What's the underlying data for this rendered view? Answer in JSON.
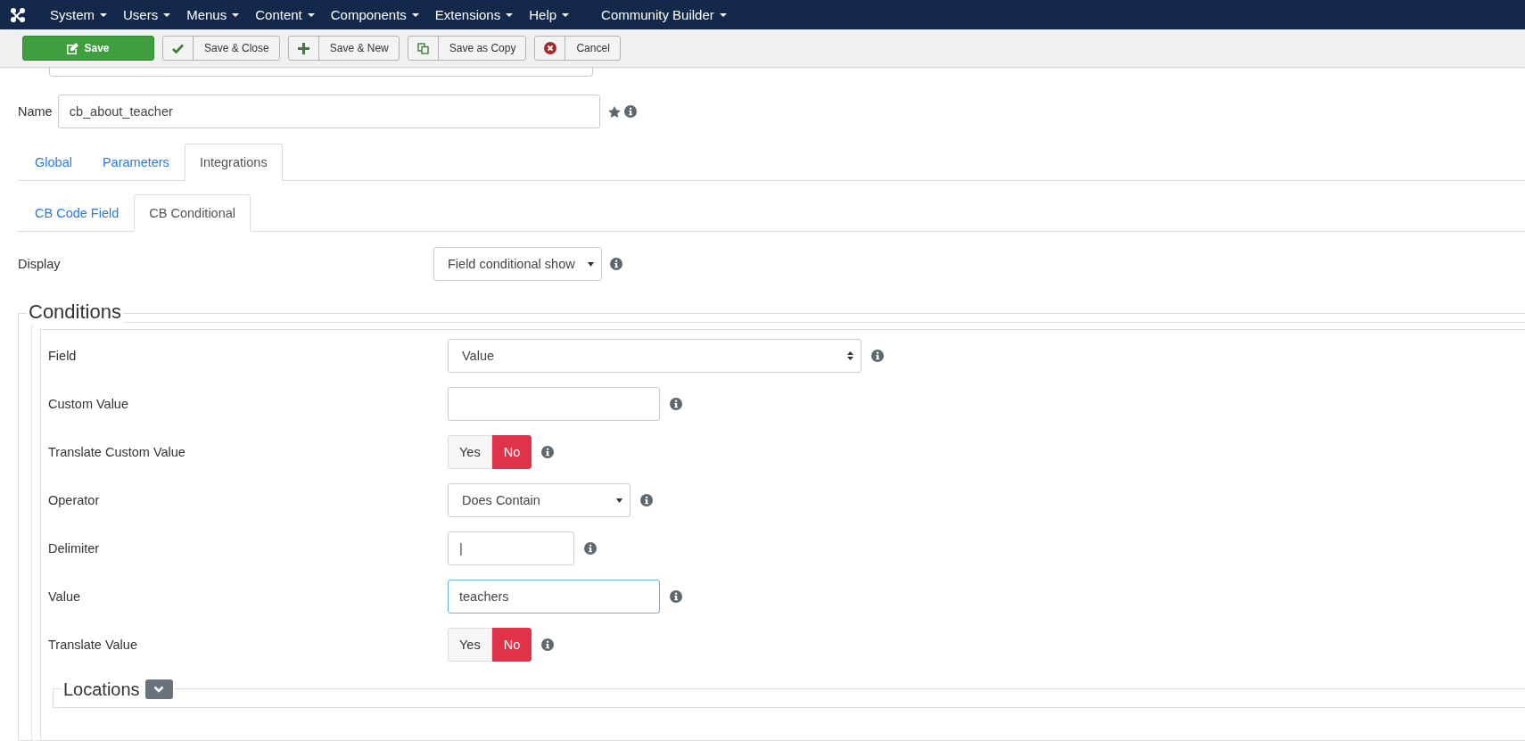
{
  "menu": {
    "items": [
      {
        "label": "System"
      },
      {
        "label": "Users"
      },
      {
        "label": "Menus"
      },
      {
        "label": "Content"
      },
      {
        "label": "Components"
      },
      {
        "label": "Extensions"
      },
      {
        "label": "Help"
      },
      {
        "label": "Community Builder"
      }
    ]
  },
  "toolbar": {
    "buttons": [
      {
        "label": "Save",
        "kind": "save"
      },
      {
        "label": "Save & Close",
        "kind": "check"
      },
      {
        "label": "Save & New",
        "kind": "plus"
      },
      {
        "label": "Save as Copy",
        "kind": "copy"
      },
      {
        "label": "Cancel",
        "kind": "cancel"
      }
    ]
  },
  "name_field": {
    "label": "Name",
    "value": "cb_about_teacher"
  },
  "tabs": [
    {
      "label": "Global",
      "selected": false
    },
    {
      "label": "Parameters",
      "selected": false
    },
    {
      "label": "Integrations",
      "selected": true
    }
  ],
  "subtabs": [
    {
      "label": "CB Code Field",
      "selected": false
    },
    {
      "label": "CB Conditional",
      "selected": true
    }
  ],
  "display": {
    "label": "Display",
    "value": "Field conditional show"
  },
  "conditions": {
    "title": "Conditions",
    "rows": [
      {
        "label": "Field",
        "kind": "listbox",
        "value": "Value"
      },
      {
        "label": "Custom Value",
        "kind": "text",
        "focused": false
      },
      {
        "label": "Translate Custom Value",
        "kind": "toggle",
        "options": [
          {
            "label": "Yes",
            "selected": false
          },
          {
            "label": "No",
            "selected": true
          }
        ]
      },
      {
        "label": "Operator",
        "kind": "select",
        "value": "Does Contain"
      },
      {
        "label": "Delimiter",
        "kind": "text",
        "value": "|",
        "focused": false
      },
      {
        "label": "Value",
        "kind": "text",
        "value": "teachers",
        "focused": true
      },
      {
        "label": "Translate Value",
        "kind": "toggle",
        "options": [
          {
            "label": "Yes",
            "selected": false
          },
          {
            "label": "No",
            "selected": true
          }
        ]
      }
    ],
    "locations": {
      "title": "Locations",
      "expanded": false
    }
  }
}
